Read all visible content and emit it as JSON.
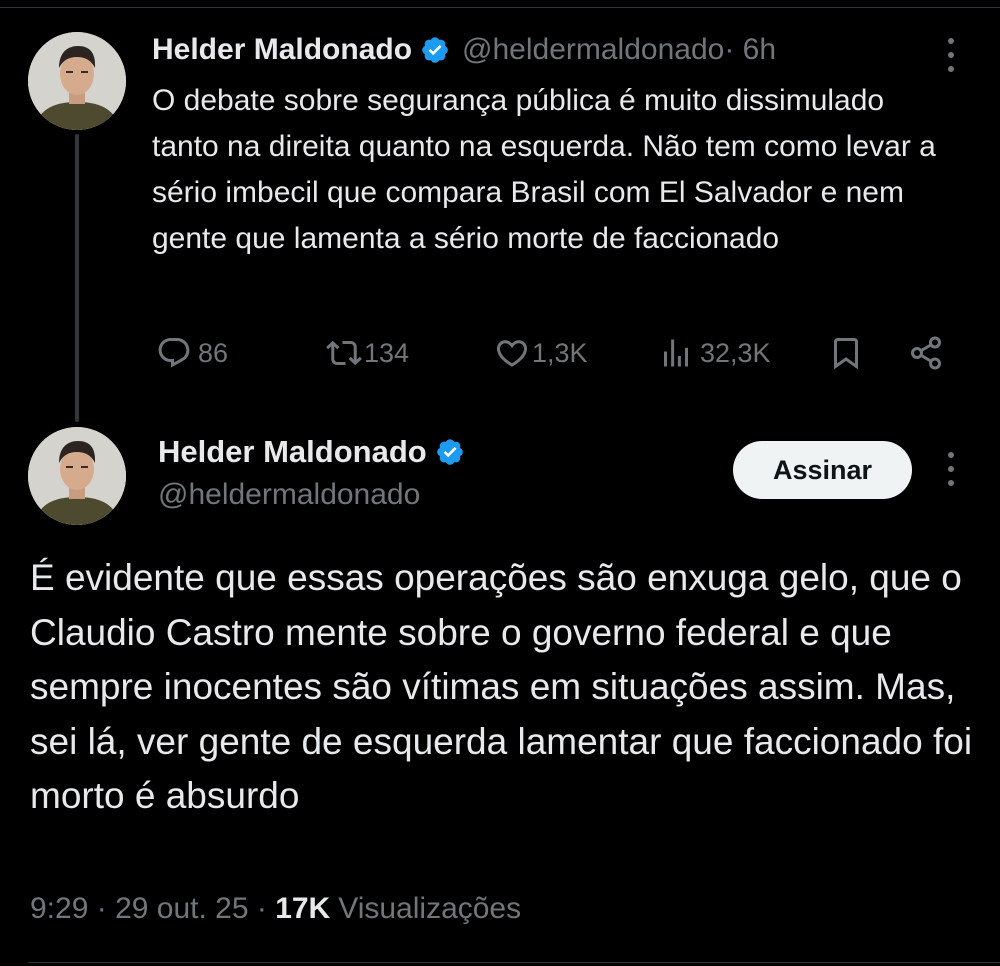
{
  "parent_tweet": {
    "display_name": "Helder Maldonado",
    "handle": "@heldermaldonado",
    "time": " · 6h",
    "text": "O debate sobre segurança pública é muito dissimulado tanto na direita quanto na esquerda. Não tem como levar a sério imbecil que compara Brasil com El Salvador e nem gente que lamenta a sério morte de faccionado",
    "metrics": {
      "replies": "86",
      "reposts": "134",
      "likes": "1,3K",
      "views": "32,3K"
    }
  },
  "main_tweet": {
    "display_name": "Helder Maldonado",
    "handle": "@heldermaldonado",
    "subscribe_label": "Assinar",
    "text": "É evidente que essas operações são enxuga gelo, que o Claudio Castro mente sobre o governo federal e que sempre inocentes são vítimas em situações assim. Mas, sei lá, ver gente de esquerda lamentar que faccionado foi morto é absurdo",
    "time": "9:29",
    "date": "29 out. 25",
    "views_count": "17K",
    "views_label": "Visualizações"
  },
  "icons": {
    "verified": "verified-badge-icon",
    "more": "more-vertical-icon",
    "reply": "reply-icon",
    "repost": "repost-icon",
    "like": "like-icon",
    "views": "views-icon",
    "bookmark": "bookmark-icon",
    "share": "share-icon"
  },
  "colors": {
    "background": "#000000",
    "text_primary": "#e7e9ea",
    "text_secondary": "#71767b",
    "verified_blue": "#1d9bf0",
    "button_bg": "#eff3f4"
  }
}
